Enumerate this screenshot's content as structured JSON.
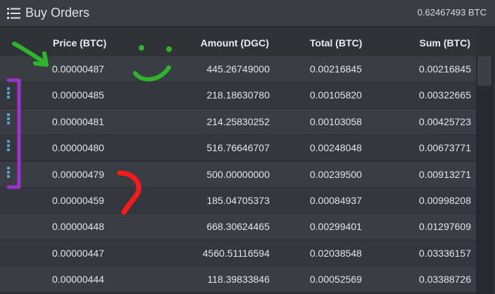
{
  "panel": {
    "title": "Buy Orders",
    "total": "0.62467493 BTC",
    "icon": "list-icon"
  },
  "columns": {
    "price": "Price (BTC)",
    "amount": "Amount (DGC)",
    "total": "Total (BTC)",
    "sum": "Sum (BTC)"
  },
  "rows": [
    {
      "price": "0.00000487",
      "amount": "445.26749000",
      "total": "0.00216845",
      "sum": "0.00216845"
    },
    {
      "price": "0.00000485",
      "amount": "218.18630780",
      "total": "0.00105820",
      "sum": "0.00322665"
    },
    {
      "price": "0.00000481",
      "amount": "214.25830252",
      "total": "0.00103058",
      "sum": "0.00425723"
    },
    {
      "price": "0.00000480",
      "amount": "516.76646707",
      "total": "0.00248048",
      "sum": "0.00673771"
    },
    {
      "price": "0.00000479",
      "amount": "500.00000000",
      "total": "0.00239500",
      "sum": "0.00913271"
    },
    {
      "price": "0.00000459",
      "amount": "185.04705373",
      "total": "0.00084937",
      "sum": "0.00998208"
    },
    {
      "price": "0.00000448",
      "amount": "668.30624465",
      "total": "0.00299401",
      "sum": "0.01297609"
    },
    {
      "price": "0.00000447",
      "amount": "4560.51116594",
      "total": "0.02038548",
      "sum": "0.03336157"
    },
    {
      "price": "0.00000444",
      "amount": "118.39833846",
      "total": "0.00052569",
      "sum": "0.03388726"
    }
  ],
  "colors": {
    "annotation_green": "#2fb52a",
    "annotation_purple": "#9b34c8",
    "annotation_red": "#ff1a1a",
    "grip_blue": "#5ba3c7"
  }
}
